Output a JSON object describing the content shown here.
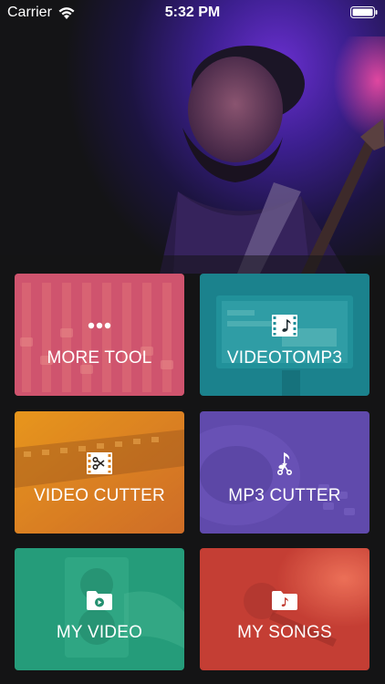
{
  "status_bar": {
    "carrier": "Carrier",
    "time": "5:32 PM",
    "wifi_icon": "wifi-icon",
    "battery_icon": "battery-icon"
  },
  "colors": {
    "more_tool": "#d95f6e",
    "video_to_mp3": "#1f8e98",
    "video_cutter": "#e4891d",
    "mp3_cutter": "#6c52b8",
    "my_video": "#2aa380",
    "my_songs": "#d0463b"
  },
  "tiles": {
    "more_tool": {
      "label": "MORE TOOL",
      "icon": "more-dots-icon"
    },
    "video_to_mp3": {
      "label": "VIDEOTOMP3",
      "icon": "video-music-icon"
    },
    "video_cutter": {
      "label": "VIDEO CUTTER",
      "icon": "video-scissors-icon"
    },
    "mp3_cutter": {
      "label": "MP3 CUTTER",
      "icon": "music-scissors-icon"
    },
    "my_video": {
      "label": "MY VIDEO",
      "icon": "video-folder-icon"
    },
    "my_songs": {
      "label": "MY SONGS",
      "icon": "music-folder-icon"
    }
  }
}
